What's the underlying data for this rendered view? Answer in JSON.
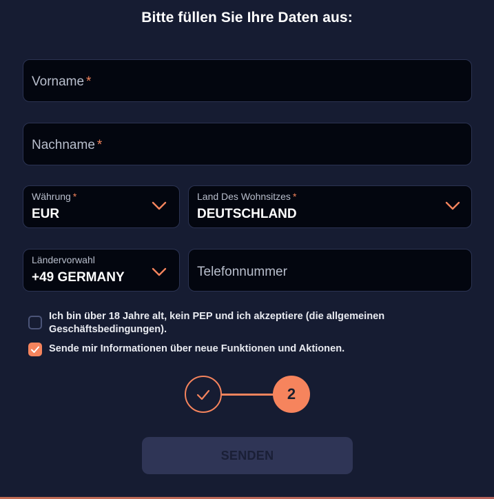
{
  "form": {
    "title": "Bitte füllen Sie Ihre Daten aus:",
    "first_name": {
      "placeholder": "Vorname",
      "required_mark": "*"
    },
    "last_name": {
      "placeholder": "Nachname",
      "required_mark": "*"
    },
    "currency": {
      "label": "Währung",
      "required_mark": "*",
      "value": "EUR"
    },
    "country": {
      "label": "Land Des Wohnsitzes",
      "required_mark": "*",
      "value": "DEUTSCHLAND"
    },
    "dial_code": {
      "label": "Ländervorwahl",
      "value": "+49 GERMANY"
    },
    "phone": {
      "placeholder": "Telefonnummer"
    },
    "terms_checkbox": {
      "checked": false,
      "label": "Ich bin über 18 Jahre alt, kein PEP und ich akzeptiere (die allgemeinen Geschäftsbedingungen)."
    },
    "marketing_checkbox": {
      "checked": true,
      "label": "Sende mir Informationen über neue Funktionen und Aktionen."
    },
    "steps": {
      "completed_icon": "check-icon",
      "current_step": "2"
    },
    "submit_label": "SENDEN"
  },
  "colors": {
    "background": "#161c32",
    "field_background": "#03060f",
    "field_border": "#2b3352",
    "accent": "#f6845d",
    "button_disabled": "#2f3556"
  },
  "icons": {
    "dropdown": "chevron-down-icon",
    "checkmark": "check-icon"
  }
}
